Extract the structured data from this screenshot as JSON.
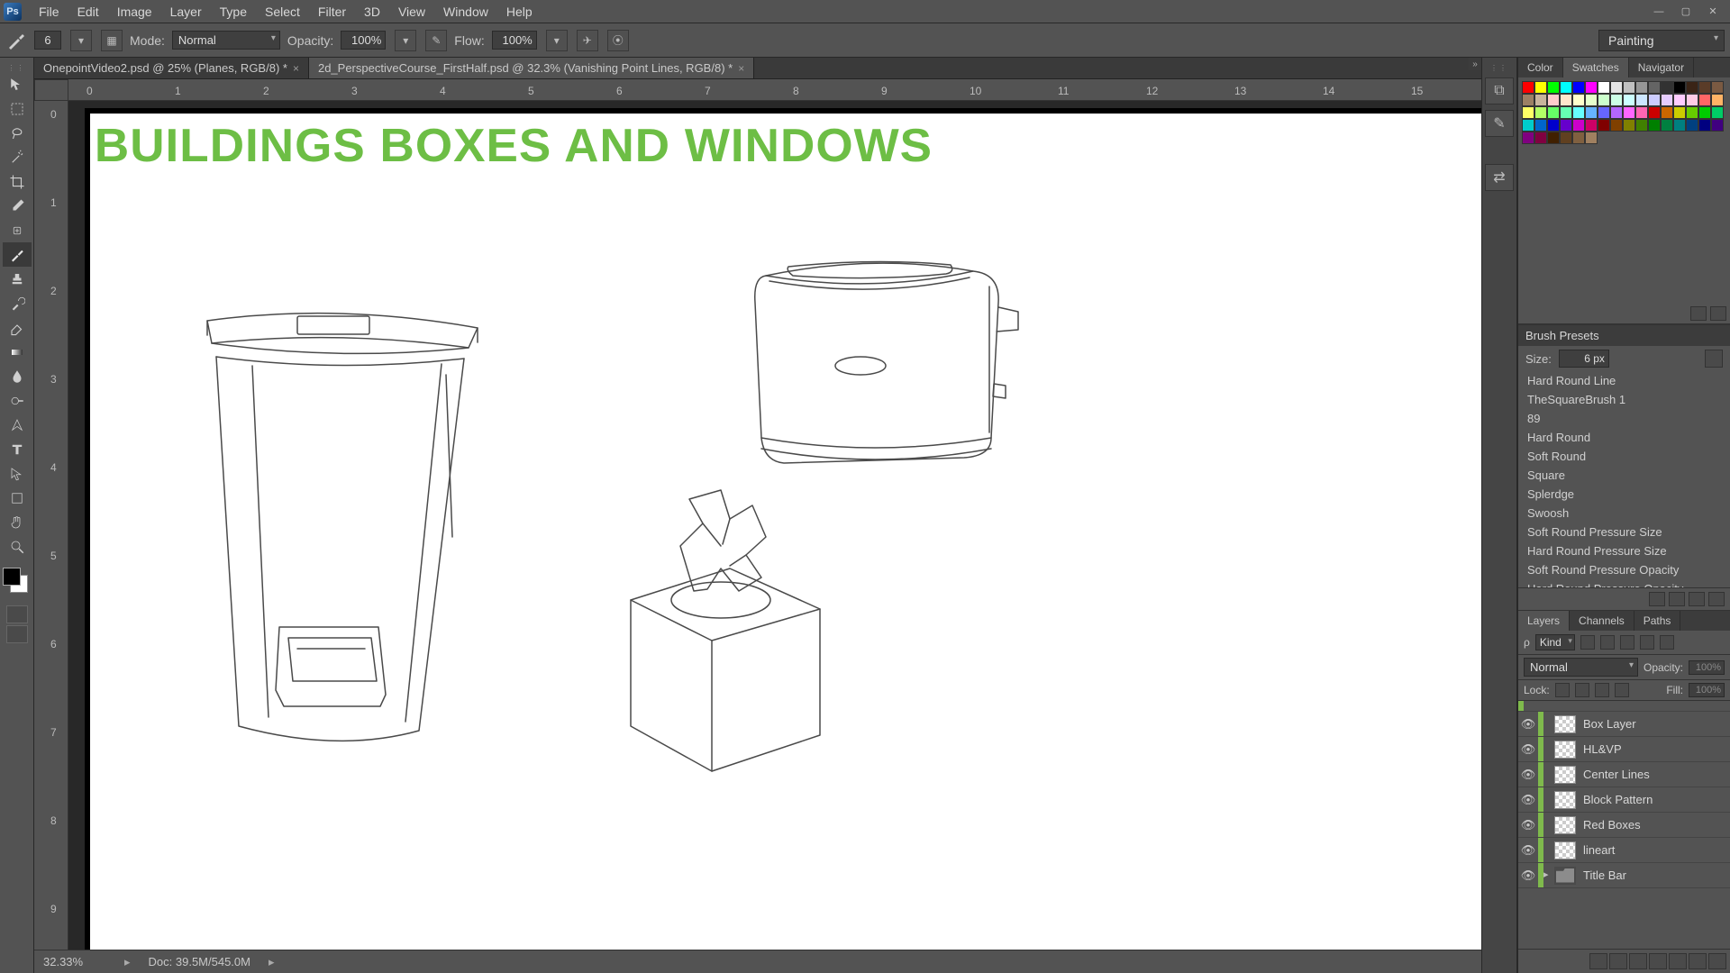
{
  "menus": [
    "File",
    "Edit",
    "Image",
    "Layer",
    "Type",
    "Select",
    "Filter",
    "3D",
    "View",
    "Window",
    "Help"
  ],
  "options": {
    "size_value": "6",
    "mode_label": "Mode:",
    "mode_value": "Normal",
    "opacity_label": "Opacity:",
    "opacity_value": "100%",
    "flow_label": "Flow:",
    "flow_value": "100%"
  },
  "workspace": "Painting",
  "doc_tabs": [
    {
      "label": "2d_PerspectiveCourse_FirstHalf.psd @ 32.3% (Vanishing Point Lines, RGB/8) *",
      "active": true
    },
    {
      "label": "OnepointVideo2.psd @ 25% (Planes, RGB/8) *",
      "active": false
    }
  ],
  "ruler_h": [
    "0",
    "1",
    "2",
    "3",
    "4",
    "5",
    "6",
    "7",
    "8",
    "9",
    "10",
    "11",
    "12",
    "13",
    "14",
    "15"
  ],
  "ruler_v": [
    "0",
    "1",
    "2",
    "3",
    "4",
    "5",
    "6",
    "7",
    "8",
    "9"
  ],
  "canvas_title": "BUILDINGS BOXES AND WINDOWS",
  "status": {
    "zoom": "32.33%",
    "doc": "Doc: 39.5M/545.0M"
  },
  "swatch_colors": [
    "#ff0000",
    "#ffff00",
    "#00ff00",
    "#00ffff",
    "#0000ff",
    "#ff00ff",
    "#ffffff",
    "#e4e4e4",
    "#c0c0c0",
    "#969696",
    "#646464",
    "#323232",
    "#000000",
    "#3a2416",
    "#5a3c28",
    "#7a5a42",
    "#9c8064",
    "#c8b49c",
    "#ffcccc",
    "#ffe6cc",
    "#ffffcc",
    "#e6ffcc",
    "#ccffcc",
    "#ccffe6",
    "#ccffff",
    "#cce6ff",
    "#ccccff",
    "#e6ccff",
    "#ffccff",
    "#ffcce6",
    "#ff6666",
    "#ffb366",
    "#ffff66",
    "#b3ff66",
    "#66ff66",
    "#66ffb3",
    "#66ffff",
    "#66b3ff",
    "#6666ff",
    "#b366ff",
    "#ff66ff",
    "#ff66b3",
    "#cc0000",
    "#cc6600",
    "#cccc00",
    "#66cc00",
    "#00cc00",
    "#00cc66",
    "#00cccc",
    "#0066cc",
    "#0000cc",
    "#6600cc",
    "#cc00cc",
    "#cc0066",
    "#800000",
    "#804000",
    "#808000",
    "#408000",
    "#008000",
    "#008040",
    "#008080",
    "#004080",
    "#000080",
    "#400080",
    "#800080",
    "#800040",
    "#402000",
    "#604020",
    "#806040",
    "#a08060"
  ],
  "color_tabs": [
    "Color",
    "Swatches",
    "Navigator"
  ],
  "brush_presets": {
    "title": "Brush Presets",
    "size_label": "Size:",
    "size_value": "6 px",
    "items": [
      "Hard Round Line",
      "TheSquareBrush 1",
      "89",
      "Hard Round",
      "Soft Round",
      "Square",
      "Splerdge",
      "Swoosh",
      "Soft Round Pressure Size",
      "Hard Round Pressure Size",
      "Soft Round Pressure Opacity",
      "Hard Round Pressure Opacity"
    ]
  },
  "layer_tabs": [
    "Layers",
    "Channels",
    "Paths"
  ],
  "layer_opts": {
    "kind": "Kind",
    "blend": "Normal",
    "opacity_label": "Opacity:",
    "opacity_value": "100%",
    "lock_label": "Lock:",
    "fill_label": "Fill:",
    "fill_value": "100%"
  },
  "layers": [
    {
      "name": "Box Layer",
      "visible": true,
      "type": "layer"
    },
    {
      "name": "HL&VP",
      "visible": true,
      "type": "layer"
    },
    {
      "name": "Center Lines",
      "visible": true,
      "type": "layer"
    },
    {
      "name": "Block Pattern",
      "visible": true,
      "type": "layer"
    },
    {
      "name": "Red Boxes",
      "visible": true,
      "type": "layer"
    },
    {
      "name": "lineart",
      "visible": true,
      "type": "layer"
    },
    {
      "name": "Title Bar",
      "visible": true,
      "type": "folder"
    }
  ]
}
